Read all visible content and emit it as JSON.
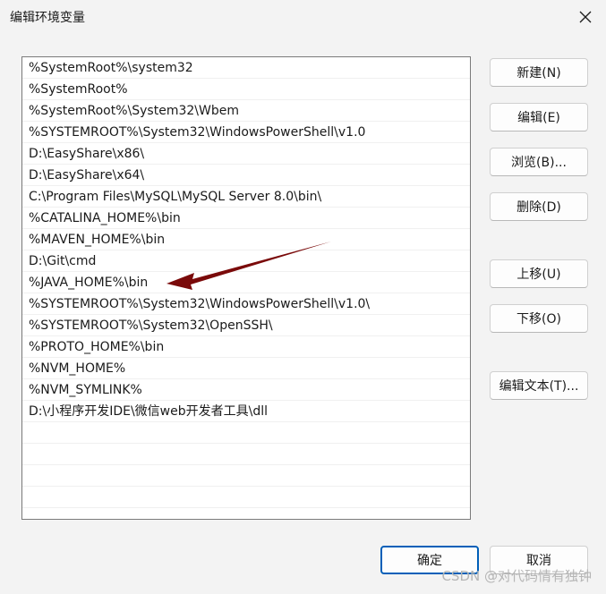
{
  "window": {
    "title": "编辑环境变量"
  },
  "paths": [
    "%SystemRoot%\\system32",
    "%SystemRoot%",
    "%SystemRoot%\\System32\\Wbem",
    "%SYSTEMROOT%\\System32\\WindowsPowerShell\\v1.0",
    "D:\\EasyShare\\x86\\",
    "D:\\EasyShare\\x64\\",
    "C:\\Program Files\\MySQL\\MySQL Server 8.0\\bin\\",
    "%CATALINA_HOME%\\bin",
    "%MAVEN_HOME%\\bin",
    "D:\\Git\\cmd",
    "%JAVA_HOME%\\bin",
    "%SYSTEMROOT%\\System32\\WindowsPowerShell\\v1.0\\",
    "%SYSTEMROOT%\\System32\\OpenSSH\\",
    "%PROTO_HOME%\\bin",
    "%NVM_HOME%",
    "%NVM_SYMLINK%",
    "D:\\小程序开发IDE\\微信web开发者工具\\dll"
  ],
  "buttons": {
    "new": "新建(N)",
    "edit": "编辑(E)",
    "browse": "浏览(B)...",
    "delete": "删除(D)",
    "move_up": "上移(U)",
    "move_down": "下移(O)",
    "edit_text": "编辑文本(T)...",
    "ok": "确定",
    "cancel": "取消"
  },
  "watermark": "CSDN @对代码情有独钟",
  "colors": {
    "annotation_arrow": "#7a0a0a",
    "primary_border": "#005fb8"
  }
}
